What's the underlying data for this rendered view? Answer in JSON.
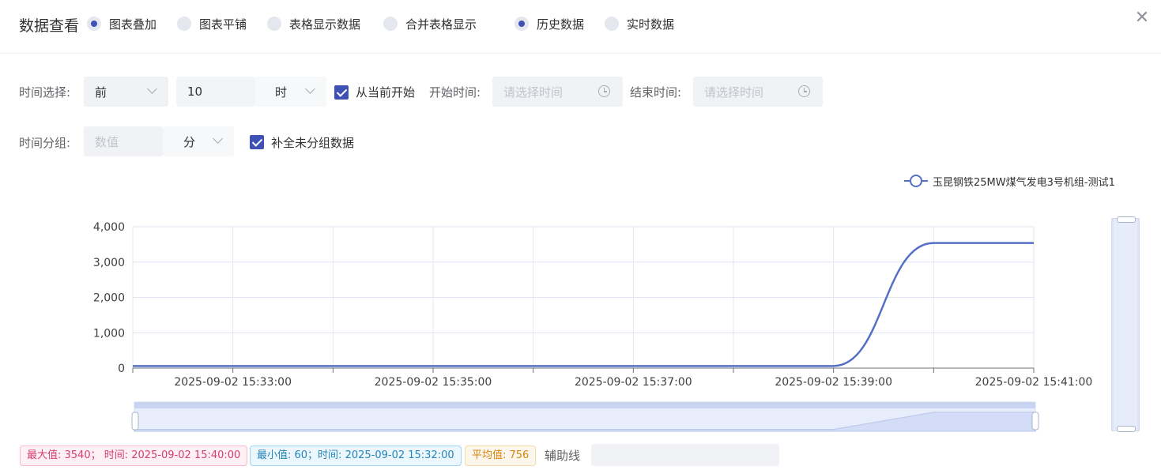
{
  "header": {
    "title": "数据查看",
    "view_modes": [
      {
        "label": "图表叠加",
        "checked": true
      },
      {
        "label": "图表平铺",
        "checked": false
      },
      {
        "label": "表格显示数据",
        "checked": false
      },
      {
        "label": "合并表格显示",
        "checked": false
      }
    ],
    "data_modes": [
      {
        "label": "历史数据",
        "checked": true
      },
      {
        "label": "实时数据",
        "checked": false
      }
    ],
    "close_icon": "close-icon"
  },
  "filters": {
    "time_label": "时间选择:",
    "direction": "前",
    "amount": "10",
    "unit": "时",
    "from_now_label": "从当前开始",
    "from_now_checked": true,
    "start_label": "开始时间:",
    "start_placeholder": "请选择时间",
    "end_label": "结束时间:",
    "end_placeholder": "请选择时间",
    "group_label": "时间分组:",
    "group_placeholder": "数值",
    "group_unit": "分",
    "fill_label": "补全未分组数据",
    "fill_checked": true
  },
  "colors": {
    "accent": "#3f51b5",
    "series": "#5470c6"
  },
  "chart_data": {
    "type": "line",
    "legend_position": "top-right",
    "grid": true,
    "ylim": [
      0,
      4000
    ],
    "y_ticks": [
      "0",
      "1,000",
      "2,000",
      "3,000",
      "4,000"
    ],
    "x_ticks": [
      "2025-09-02 15:33:00",
      "2025-09-02 15:35:00",
      "2025-09-02 15:37:00",
      "2025-09-02 15:39:00",
      "2025-09-02 15:41:00"
    ],
    "series": [
      {
        "name": "玉昆钢铁25MW煤气发电3号机组-测试1",
        "points": [
          [
            "2025-09-02 15:32:00",
            60
          ],
          [
            "2025-09-02 15:38:00",
            60
          ],
          [
            "2025-09-02 15:39:00",
            60
          ],
          [
            "2025-09-02 15:40:00",
            3540
          ],
          [
            "2025-09-02 15:41:00",
            3540
          ]
        ]
      }
    ]
  },
  "stats": {
    "max": "最大值: 3540； 时间: 2025-09-02 15:40:00",
    "min": "最小值: 60；时间: 2025-09-02 15:32:00",
    "avg": "平均值: 756"
  },
  "aux_label": "辅助线"
}
